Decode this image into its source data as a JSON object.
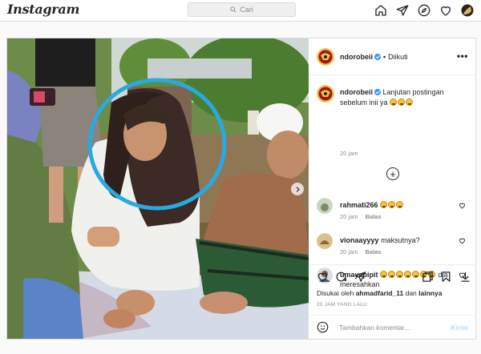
{
  "nav": {
    "logo": "Instagram",
    "search_placeholder": "Cari",
    "icons": [
      "home-icon",
      "direct-icon",
      "explore-icon",
      "activity-heart-icon",
      "profile-avatar"
    ]
  },
  "post": {
    "author": "ndorobeii",
    "follow_status": "Diikuti",
    "verified": true,
    "caption": {
      "user": "ndorobeii",
      "text": "Lanjutan postingan sebelum inii ya",
      "emoji_count": 3,
      "time": "20 jam"
    },
    "comments": [
      {
        "user": "rahmati266",
        "text": "",
        "emoji_count": 3,
        "time": "20 jam",
        "reply": "Balas"
      },
      {
        "user": "vionaayyyy",
        "text": "maksutnya?",
        "emoji_count": 0,
        "time": "20 jam",
        "reply": "Balas"
      },
      {
        "user": "umayapipit",
        "text": "dia meresahkan",
        "emoji_count": 7,
        "time": "20 jam",
        "reply": "Balas"
      }
    ],
    "likes": {
      "prefix": "Disukai oleh",
      "user": "ahmadfarid_11",
      "middle": "dan",
      "suffix": "lainnya"
    },
    "timestamp": "20 JAM YANG LALU",
    "add_comment_placeholder": "Tambahkan komentar...",
    "post_button": "Kirim"
  },
  "colors": {
    "accent_blue": "#3897f0",
    "highlight_circle": "#29a9e0",
    "text": "#262626",
    "muted": "#8e8e8e"
  }
}
